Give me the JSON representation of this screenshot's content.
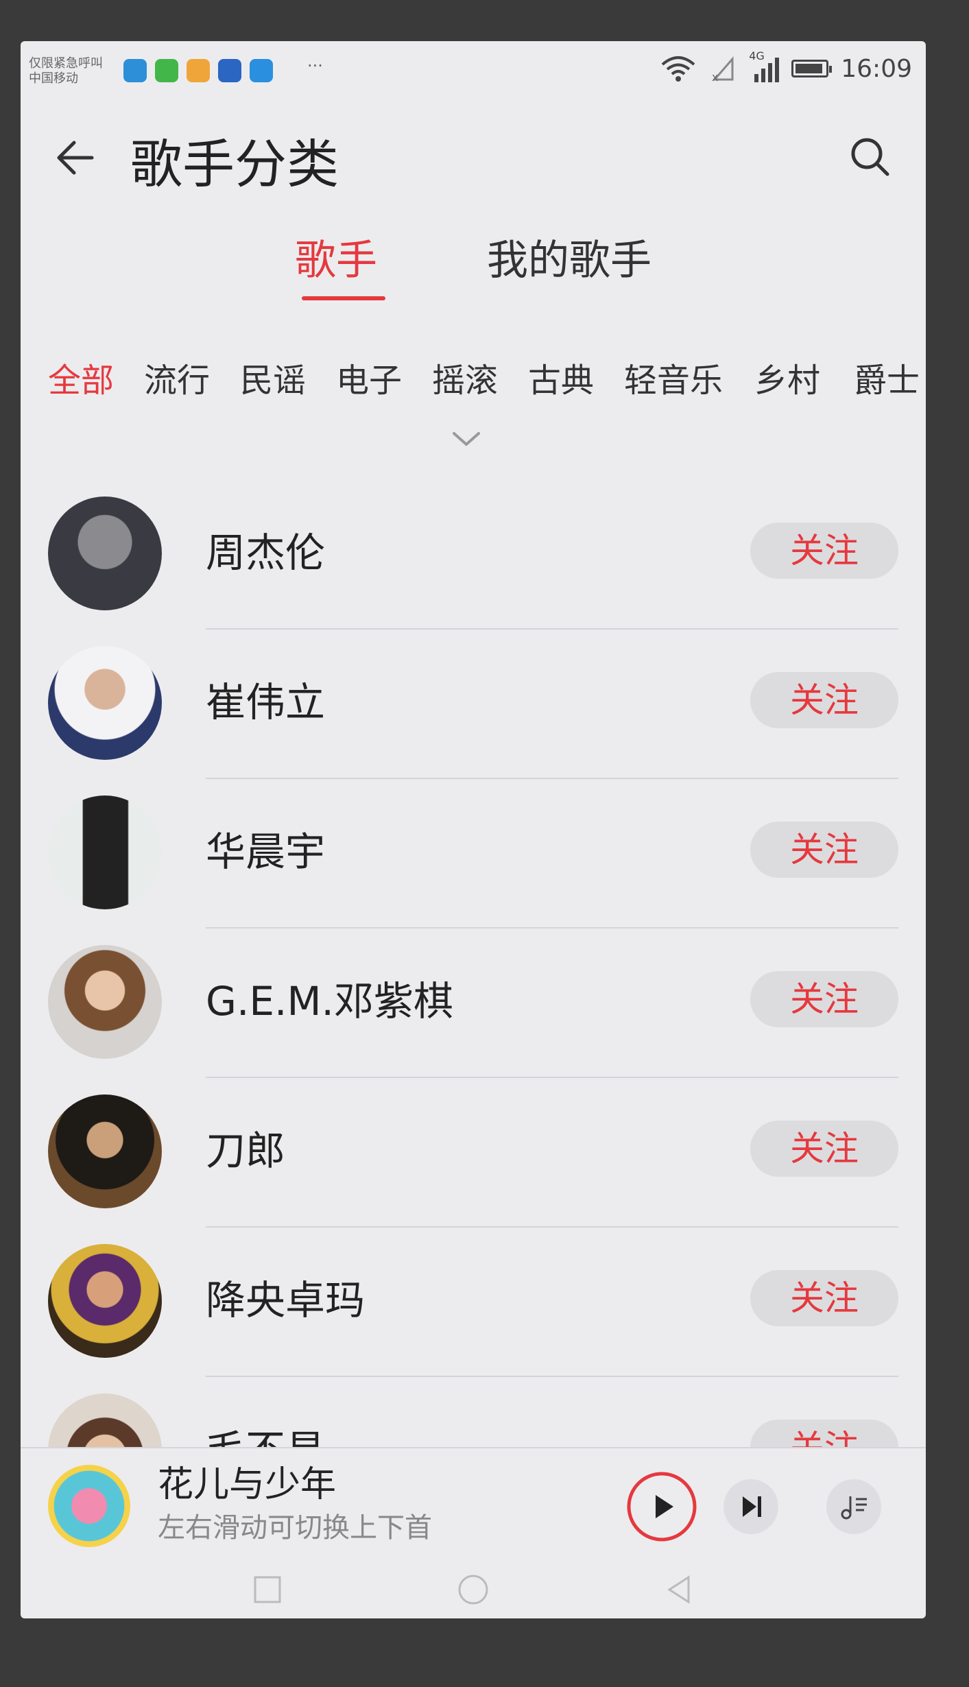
{
  "status_bar": {
    "carrier_line1": "仅限紧急呼叫",
    "carrier_line2": "中国移动",
    "more": "···",
    "network": "4G",
    "time": "16:09",
    "notification_icons": [
      "cloud-icon",
      "wechat-icon",
      "app-icon",
      "app-icon",
      "message-icon"
    ]
  },
  "header": {
    "title": "歌手分类",
    "back_icon": "back-arrow-icon",
    "search_icon": "search-icon"
  },
  "tabs": [
    {
      "label": "歌手",
      "active": true
    },
    {
      "label": "我的歌手",
      "active": false
    }
  ],
  "genres": [
    {
      "label": "全部",
      "active": true
    },
    {
      "label": "流行",
      "active": false
    },
    {
      "label": "民谣",
      "active": false
    },
    {
      "label": "电子",
      "active": false
    },
    {
      "label": "摇滚",
      "active": false
    },
    {
      "label": "古典",
      "active": false
    },
    {
      "label": "轻音乐",
      "active": false
    },
    {
      "label": "乡村",
      "active": false
    },
    {
      "label": "爵士",
      "active": false
    }
  ],
  "singers": [
    {
      "name": "周杰伦",
      "follow": "关注"
    },
    {
      "name": "崔伟立",
      "follow": "关注"
    },
    {
      "name": "华晨宇",
      "follow": "关注"
    },
    {
      "name": "G.E.M.邓紫棋",
      "follow": "关注"
    },
    {
      "name": "刀郎",
      "follow": "关注"
    },
    {
      "name": "降央卓玛",
      "follow": "关注"
    },
    {
      "name": "毛不易",
      "follow": "关注"
    }
  ],
  "player": {
    "title": "花儿与少年",
    "subtitle": "左右滑动可切换上下首",
    "play_icon": "play-icon",
    "next_icon": "next-track-icon",
    "queue_icon": "playlist-icon"
  },
  "colors": {
    "accent": "#e5393e",
    "background": "#ececef",
    "follow_bg": "#dcdcdf"
  }
}
